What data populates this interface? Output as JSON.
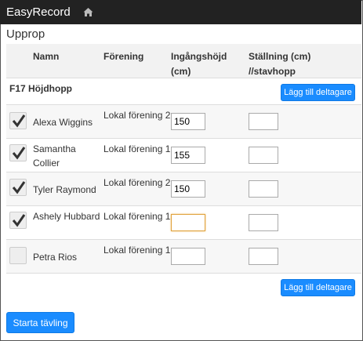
{
  "navbar": {
    "brand": "EasyRecord",
    "home_icon": "home-icon"
  },
  "page": {
    "title": "Upprop"
  },
  "table": {
    "headers": {
      "name": "Namn",
      "club": "Förening",
      "entry_height": "Ingångshöjd (cm)",
      "standing": "Ställning (cm) //stavhopp"
    },
    "group": {
      "title": "F17 Höjdhopp",
      "add_button": "Lägg till deltagare"
    },
    "rows": [
      {
        "checked": true,
        "name": "Alexa Wiggins",
        "club": "Lokal förening 2",
        "entry_height": "150",
        "standing": ""
      },
      {
        "checked": true,
        "name": "Samantha Collier",
        "club": "Lokal förening 1",
        "entry_height": "155",
        "standing": ""
      },
      {
        "checked": true,
        "name": "Tyler Raymond",
        "club": "Lokal förening 2",
        "entry_height": "150",
        "standing": ""
      },
      {
        "checked": true,
        "name": "Ashely Hubbard",
        "club": "Lokal förening 1",
        "entry_height": "",
        "standing": ""
      },
      {
        "checked": false,
        "name": "Petra Rios",
        "club": "Lokal förening 1",
        "entry_height": "",
        "standing": ""
      }
    ],
    "bottom_add_button": "Lägg till deltagare"
  },
  "footer": {
    "start_button": "Starta tävling"
  },
  "colors": {
    "navbar": "#222222",
    "primary": "#1a8cff",
    "focus_border": "#e0a23c"
  }
}
